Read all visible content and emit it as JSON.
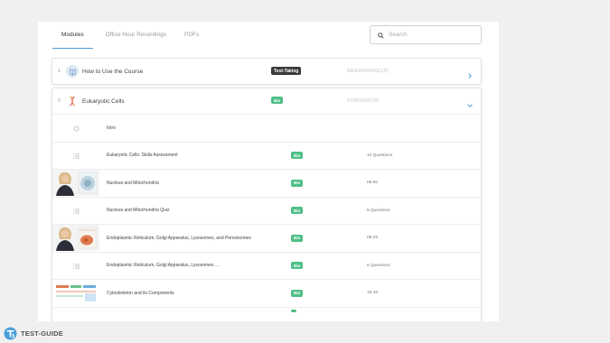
{
  "tabs": [
    {
      "label": "Modules",
      "active": true
    },
    {
      "label": "Office Hour Recordings",
      "active": false
    },
    {
      "label": "PDFs",
      "active": false
    }
  ],
  "search": {
    "placeholder": "Search",
    "icon": "search-icon"
  },
  "modules": [
    {
      "number": "1",
      "title": "How to Use the Course",
      "badge": "Test-Taking",
      "meta": "REASONING(13)",
      "expanded": false
    },
    {
      "number": "2",
      "title": "Eukaryotic Cells",
      "badge": "Bio",
      "meta": "CONTENT(8)",
      "expanded": true
    }
  ],
  "lessons": [
    {
      "icon": "circle-icon",
      "title": "Intro",
      "badge": "",
      "meta": ""
    },
    {
      "icon": "list-icon",
      "title": "Eukaryotic Cells: Skills Assessment",
      "badge": "Bio",
      "meta": "10 Questions"
    },
    {
      "icon": "video-thumbnail",
      "title": "Nucleus and Mitochondria",
      "badge": "Bio",
      "meta": "06:50"
    },
    {
      "icon": "list-icon",
      "title": "Nucleus and Mitochondria Quiz",
      "badge": "Bio",
      "meta": "5 Questions"
    },
    {
      "icon": "video-thumbnail",
      "title": "Endoplasmic Reticulum, Golgi Apparatus, Lysosomes, and Peroxisomes",
      "badge": "Bio",
      "meta": "05:15"
    },
    {
      "icon": "list-icon",
      "title": "Endoplasmic Reticulum, Golgi Apparatus, Lysosomes ...",
      "badge": "Bio",
      "meta": "6 Questions"
    },
    {
      "icon": "slide-thumbnail",
      "title": "Cytoskeleton and its Components",
      "badge": "Bio",
      "meta": "15:46"
    }
  ],
  "brand": {
    "name": "TEST-GUIDE"
  },
  "colors": {
    "accent": "#4a9fd8",
    "bio_badge": "#4fbf86",
    "dark_badge": "#3a3a3a"
  }
}
